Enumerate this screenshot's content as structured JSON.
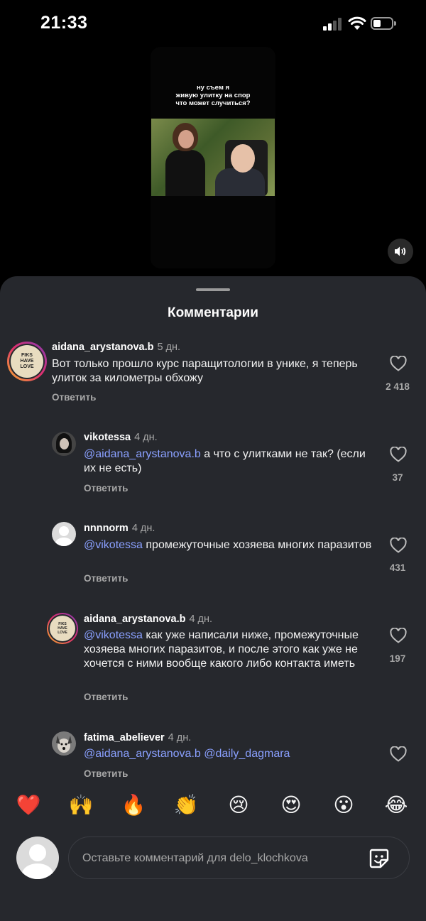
{
  "status_bar": {
    "time": "21:33"
  },
  "video": {
    "caption": "ну съем я\nживую улитку на спор\nчто может случиться?"
  },
  "sheet": {
    "title": "Комментарии"
  },
  "comments": [
    {
      "username": "aidana_arystanova.b",
      "time": "5 дн.",
      "mention": "",
      "text": "Вот только прошло курс паращитологии в унике, я теперь улиток за километры обхожу",
      "reply": "Ответить",
      "likes": "2 418"
    },
    {
      "username": "vikotessa",
      "time": "4 дн.",
      "mention": "@aidana_arystanova.b",
      "text": "а что с улитками не так? (если их не есть)",
      "reply": "Ответить",
      "likes": "37"
    },
    {
      "username": "nnnnorm",
      "time": "4 дн.",
      "mention": "@vikotessa",
      "text": "промежуточные хозяева многих паразитов",
      "reply": "Ответить",
      "likes": "431"
    },
    {
      "username": "aidana_arystanova.b",
      "time": "4 дн.",
      "mention": "@vikotessa",
      "text": "как уже написали ниже, промежуточные хозяева многих паразитов, и после этого как уже не хочется с ними вообще какого либо контакта иметь",
      "reply": "Ответить",
      "likes": "197"
    },
    {
      "username": "fatima_abeliever",
      "time": "4 дн.",
      "mention": "@aidana_arystanova.b @daily_dagmara",
      "text": "",
      "reply": "Ответить",
      "likes": ""
    }
  ],
  "avatar_lettering": "FIKS HAVE LOVE",
  "emojis": [
    "❤️",
    "🙌",
    "🔥",
    "👏",
    "😢",
    "😍",
    "😮",
    "😂"
  ],
  "composer": {
    "placeholder": "Оставьте комментарий для delo_klochkova"
  },
  "icons": {
    "sound": "speaker-icon",
    "like": "heart-outline-icon",
    "sticker": "sticker-icon"
  }
}
